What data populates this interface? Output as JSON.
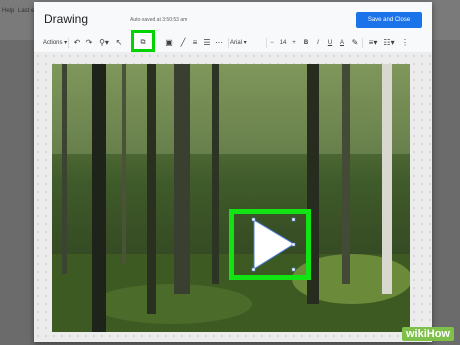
{
  "background_doc": {
    "menu_left": "Help",
    "menu_right": "Last e"
  },
  "dialog": {
    "title": "Drawing",
    "autosave": "Auto-saved at 3:50:53 am",
    "save_button": "Save and Close"
  },
  "toolbar": {
    "actions": "Actions",
    "font": "Arial",
    "font_size": "14",
    "bold": "B",
    "italic": "I",
    "underline": "U",
    "text_color": "A",
    "zoom": "100%"
  },
  "icons": [
    "undo-icon",
    "redo-icon",
    "zoom-icon",
    "select-icon",
    "shape-icon",
    "image-icon",
    "line-color-icon",
    "line-weight-icon",
    "line-dash-icon",
    "align-icon",
    "more-icon"
  ],
  "highlight_color": "#00d300",
  "watermark": "wikiHow"
}
